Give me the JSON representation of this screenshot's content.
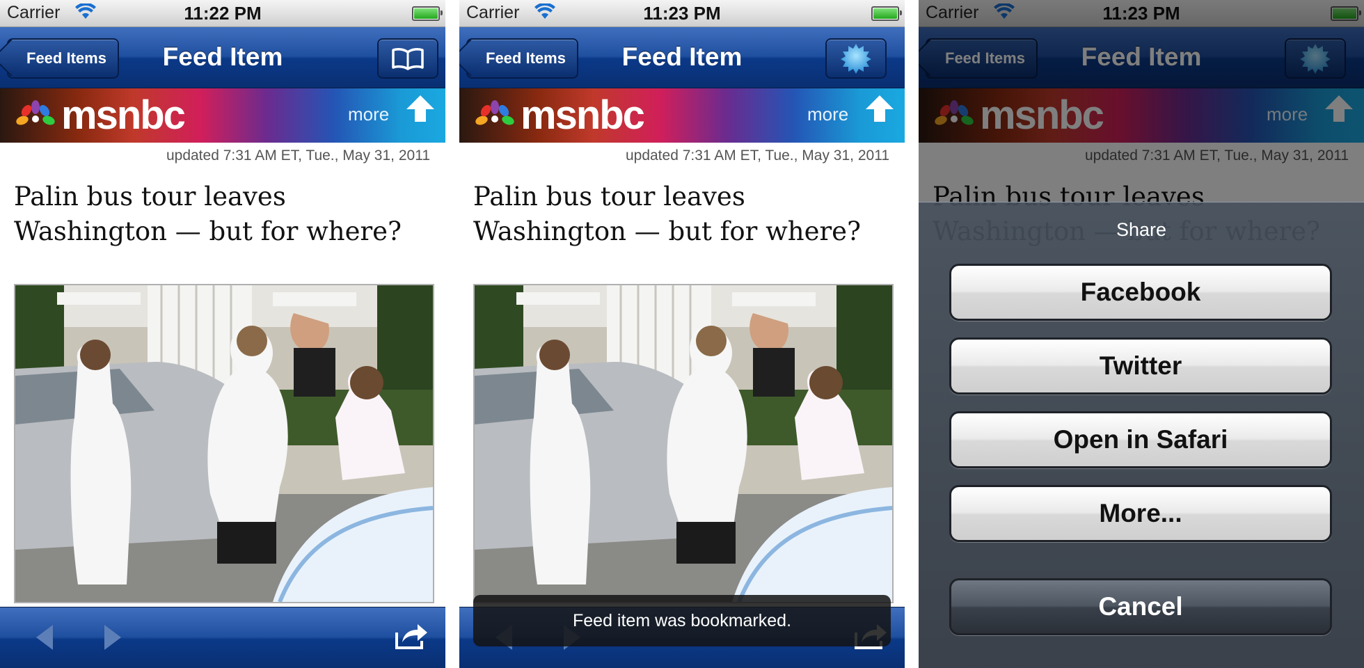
{
  "screens": [
    {
      "status": {
        "carrier": "Carrier",
        "time": "11:22 PM"
      },
      "nav": {
        "back_label": "Feed Items",
        "title": "Feed Item",
        "right_icon": "bookmark-book-icon"
      },
      "banner": {
        "brand": "msnbc",
        "more_label": "more"
      },
      "updated": "updated 7:31 AM ET, Tue., May 31, 2011",
      "headline": "Palin bus tour leaves Washington — but for where?",
      "toolbar": {
        "prev_icon": "arrow-left-icon",
        "next_icon": "arrow-right-icon",
        "share_icon": "share-icon"
      }
    },
    {
      "status": {
        "carrier": "Carrier",
        "time": "11:23 PM"
      },
      "nav": {
        "back_label": "Feed Items",
        "title": "Feed Item",
        "right_icon": "activity-spinner-icon"
      },
      "banner": {
        "brand": "msnbc",
        "more_label": "more"
      },
      "updated": "updated 7:31 AM ET, Tue., May 31, 2011",
      "headline": "Palin bus tour leaves Washington — but for where?",
      "toast": "Feed item was bookmarked."
    },
    {
      "status": {
        "carrier": "Carrier",
        "time": "11:23 PM"
      },
      "nav": {
        "back_label": "Feed Items",
        "title": "Feed Item",
        "right_icon": "activity-spinner-icon"
      },
      "banner": {
        "brand": "msnbc",
        "more_label": "more"
      },
      "updated": "updated 7:31 AM ET, Tue., May 31, 2011",
      "headline": "Palin bus tour leaves Washington — but for where?",
      "share_sheet": {
        "title": "Share",
        "buttons": [
          "Facebook",
          "Twitter",
          "Open in Safari",
          "More..."
        ],
        "cancel": "Cancel"
      }
    }
  ],
  "colors": {
    "nav_blue": "#0b3988",
    "banner_red": "#c0392b",
    "banner_blue": "#1a9ad6"
  }
}
